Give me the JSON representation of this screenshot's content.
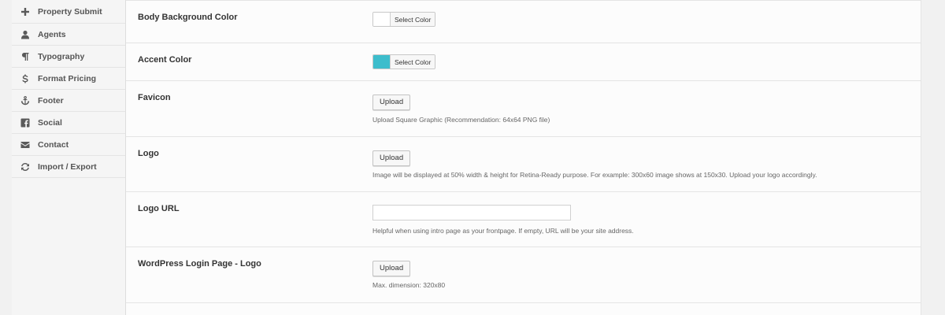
{
  "sidebar": {
    "items": [
      {
        "label": "Property Submit",
        "icon": "plus-icon"
      },
      {
        "label": "Agents",
        "icon": "user-icon"
      },
      {
        "label": "Typography",
        "icon": "pilcrow-icon"
      },
      {
        "label": "Format Pricing",
        "icon": "dollar-icon"
      },
      {
        "label": "Footer",
        "icon": "anchor-icon"
      },
      {
        "label": "Social",
        "icon": "facebook-icon"
      },
      {
        "label": "Contact",
        "icon": "envelope-icon"
      },
      {
        "label": "Import / Export",
        "icon": "refresh-icon"
      }
    ]
  },
  "settings": {
    "body_bg": {
      "label": "Body Background Color",
      "button": "Select Color",
      "color": "#ffffff"
    },
    "accent": {
      "label": "Accent Color",
      "button": "Select Color",
      "color": "#3dbdcc"
    },
    "favicon": {
      "label": "Favicon",
      "button": "Upload",
      "help": "Upload Square Graphic (Recommendation: 64x64 PNG file)"
    },
    "logo": {
      "label": "Logo",
      "button": "Upload",
      "help": "Image will be displayed at 50% width & height for Retina-Ready purpose. For example: 300x60 image shows at 150x30. Upload your logo accordingly."
    },
    "logo_url": {
      "label": "Logo URL",
      "value": "",
      "help": "Helpful when using intro page as your frontpage. If empty, URL will be your site address."
    },
    "wp_login_logo": {
      "label": "WordPress Login Page - Logo",
      "button": "Upload",
      "help": "Max. dimension: 320x80"
    }
  }
}
